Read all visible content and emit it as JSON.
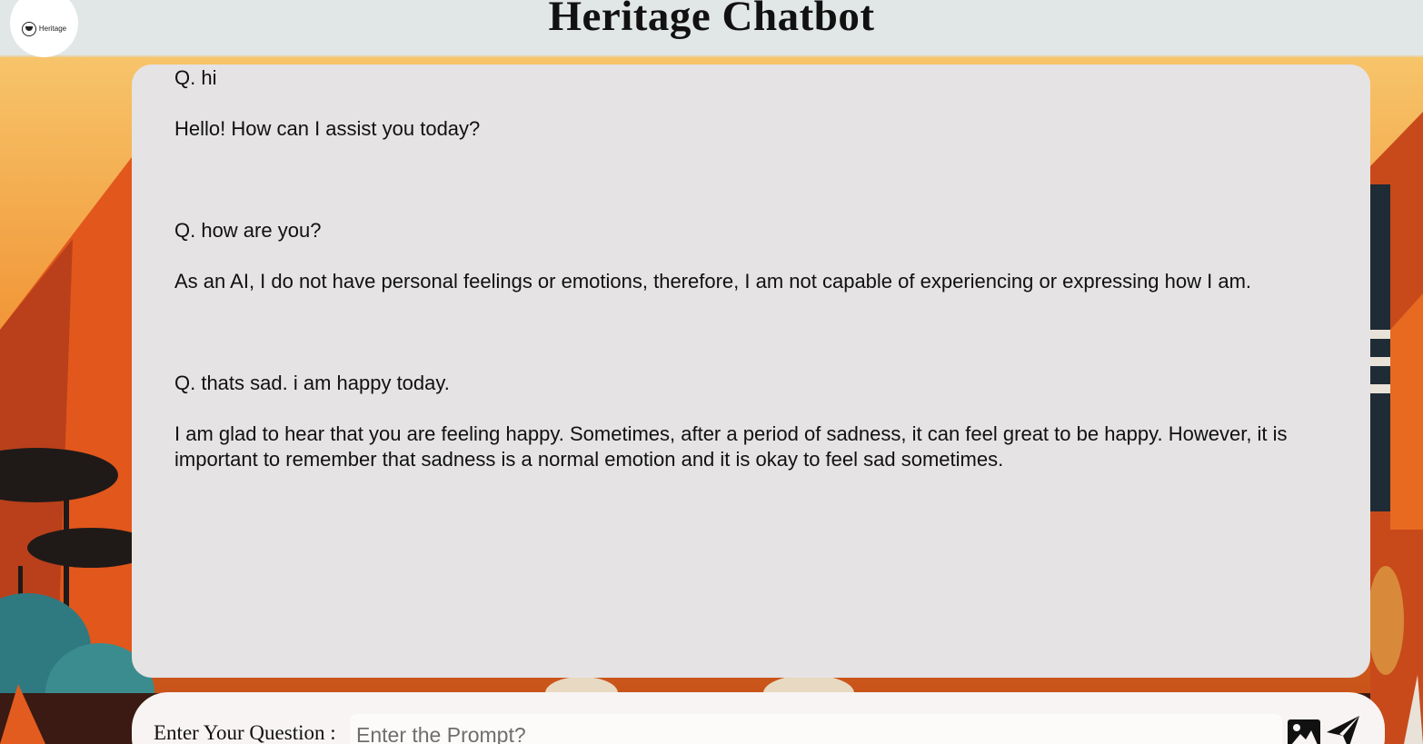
{
  "header": {
    "title": "Heritage Chatbot",
    "logo_text": "Heritage"
  },
  "chat": {
    "messages": [
      {
        "question": "Q. hi",
        "answer": "Hello! How can I assist you today?"
      },
      {
        "question": "Q. how are you?",
        "answer": "As an AI, I do not have personal feelings or emotions, therefore, I am not capable of experiencing or expressing how I am."
      },
      {
        "question": "Q. thats sad. i am happy today.",
        "answer": "I am glad to hear that you are feeling happy. Sometimes, after a period of sadness, it can feel great to be happy. However, it is important to remember that sadness is a normal emotion and it is okay to feel sad sometimes."
      }
    ]
  },
  "input": {
    "label": "Enter Your Question :",
    "placeholder": "Enter the Prompt?",
    "value": "",
    "image_icon": "image-icon",
    "send_icon": "send-icon"
  },
  "colors": {
    "header_bg": "#e1e6e6",
    "chat_bg": "#e5e3e4",
    "input_bar_bg": "#f8f4f3",
    "background_accent": "#ef7b21"
  }
}
